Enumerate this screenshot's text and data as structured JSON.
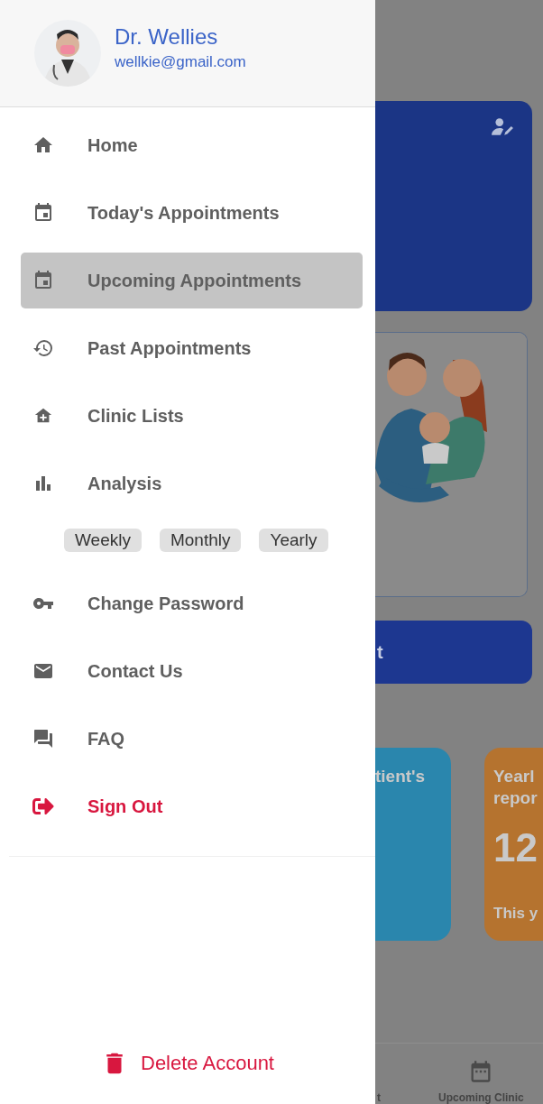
{
  "drawer": {
    "profile": {
      "name": "Dr. Wellies",
      "email": "wellkie@gmail.com"
    },
    "menu": [
      {
        "label": "Home",
        "kind": "normal",
        "selected": false
      },
      {
        "label": "Today's Appointments",
        "kind": "normal",
        "selected": false
      },
      {
        "label": "Upcoming Appointments",
        "kind": "normal",
        "selected": true
      },
      {
        "label": "Past Appointments",
        "kind": "normal",
        "selected": false
      },
      {
        "label": "Clinic Lists",
        "kind": "normal",
        "selected": false
      },
      {
        "label": "Analysis",
        "kind": "normal",
        "selected": false,
        "options": [
          "Weekly",
          "Monthly",
          "Yearly"
        ]
      },
      {
        "label": "Change Password",
        "kind": "normal",
        "selected": false
      },
      {
        "label": "Contact Us",
        "kind": "normal",
        "selected": false
      },
      {
        "label": "FAQ",
        "kind": "normal",
        "selected": false
      },
      {
        "label": "Sign Out",
        "kind": "danger",
        "selected": false
      }
    ],
    "delete_button": "Delete Account"
  },
  "background": {
    "button_text": "t",
    "stat_cards": [
      {
        "kind": "patients",
        "color": "#2a86ad",
        "lines": [
          "tient's"
        ]
      },
      {
        "kind": "yearly",
        "color": "#b5732f",
        "lines": [
          "Yearl",
          "repor"
        ],
        "value": "12",
        "footer": "This y"
      }
    ],
    "bottom_nav": [
      {
        "label": "t"
      },
      {
        "label": "Upcoming Clinic"
      }
    ]
  }
}
